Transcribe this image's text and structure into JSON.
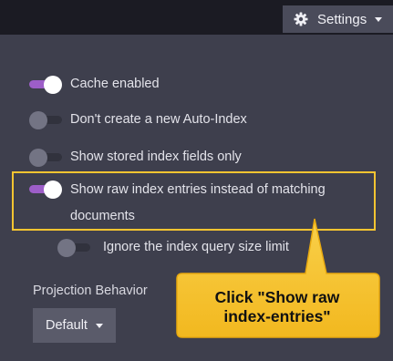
{
  "header": {
    "settings_label": "Settings",
    "settings_icon": "gear-icon"
  },
  "options": [
    {
      "label": "Cache enabled",
      "enabled": true
    },
    {
      "label": "Don't create a new Auto-Index",
      "enabled": false
    },
    {
      "label": "Show stored index fields only",
      "enabled": false
    },
    {
      "label_line1": "Show raw index entries instead of matching",
      "label_line2": "documents",
      "enabled": true
    },
    {
      "label": "Ignore the index query size limit",
      "enabled": false
    }
  ],
  "projection": {
    "label": "Projection Behavior",
    "selected": "Default"
  },
  "callout": {
    "line1": "Click \"Show raw",
    "line2": "index-entries\"",
    "color": "#f7c531"
  },
  "colors": {
    "accent": "#9d5ec8",
    "background": "#3e3f4d",
    "topbar": "#1b1b23",
    "highlight": "#f7c531"
  }
}
